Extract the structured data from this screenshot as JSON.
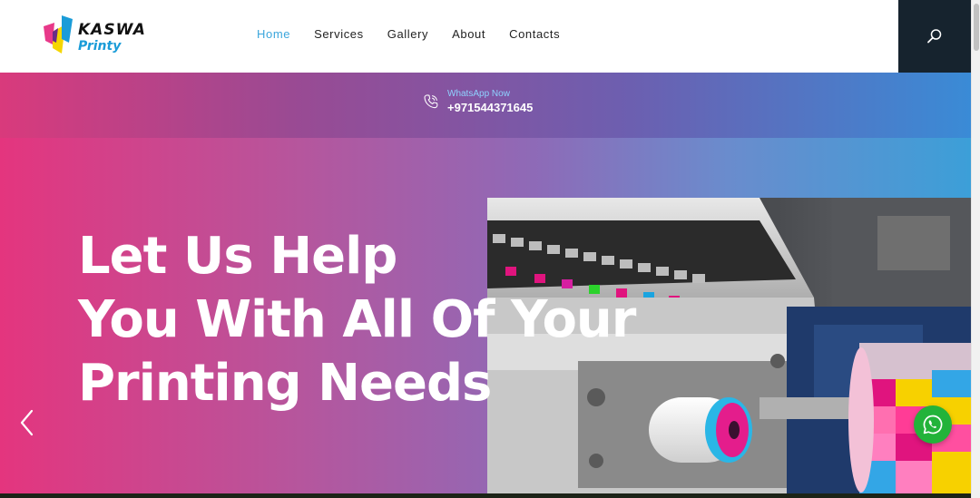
{
  "logo": {
    "line1": "KASWA",
    "line2": "Printy",
    "colors": [
      "#e8398a",
      "#f5d600",
      "#1a9cd8"
    ]
  },
  "nav": {
    "items": [
      {
        "label": "Home",
        "active": true
      },
      {
        "label": "Services",
        "active": false
      },
      {
        "label": "Gallery",
        "active": false
      },
      {
        "label": "About",
        "active": false
      },
      {
        "label": "Contacts",
        "active": false
      }
    ],
    "search_icon": "search-icon"
  },
  "banner": {
    "whatsapp_label": "WhatsApp Now",
    "phone": "+971544371645",
    "icon": "phone-icon"
  },
  "hero": {
    "title_lines": [
      "Let Us Help",
      "You With All Of Your",
      "Printing Needs"
    ],
    "prev_icon": "chevron-left-icon",
    "whatsapp_fab_icon": "whatsapp-icon"
  },
  "colors": {
    "accent": "#3ba6dc",
    "search_bg": "#16232e",
    "whatsapp_green": "#23b33a"
  }
}
